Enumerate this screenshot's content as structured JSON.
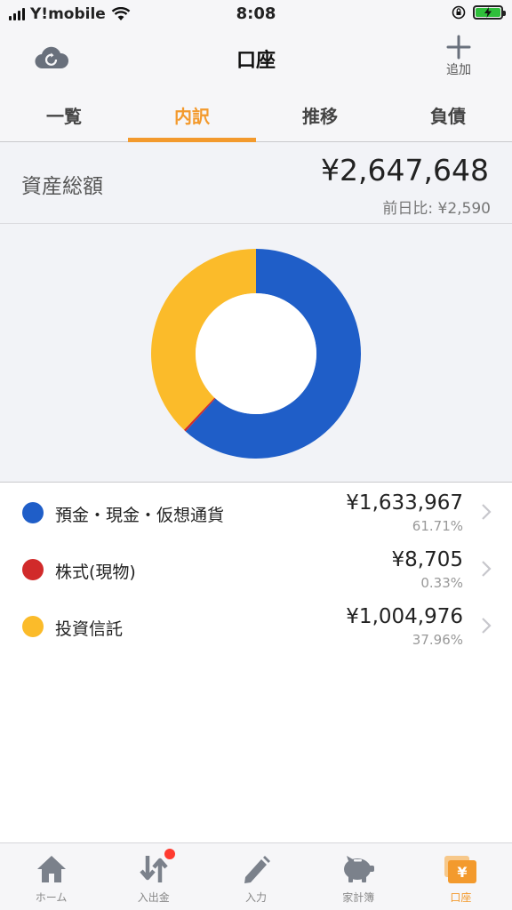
{
  "status_bar": {
    "carrier": "Y!mobile",
    "time": "8:08"
  },
  "nav": {
    "title": "口座",
    "add_label": "追加"
  },
  "tabs": [
    {
      "label": "一覧",
      "active": false
    },
    {
      "label": "内訳",
      "active": true
    },
    {
      "label": "推移",
      "active": false
    },
    {
      "label": "負債",
      "active": false
    }
  ],
  "total": {
    "label": "資産総額",
    "value": "¥2,647,648",
    "diff": "前日比: ¥2,590"
  },
  "chart_data": {
    "type": "pie",
    "categories": [
      "預金・現金・仮想通貨",
      "株式(現物)",
      "投資信託"
    ],
    "values": [
      1633967,
      8705,
      1004976
    ],
    "percentages": [
      61.71,
      0.33,
      37.96
    ],
    "colors": [
      "#1f5ec8",
      "#d12a2a",
      "#fbbb2a"
    ]
  },
  "breakdown": [
    {
      "label": "預金・現金・仮想通貨",
      "amount": "¥1,633,967",
      "percent": "61.71%",
      "color": "#1f5ec8"
    },
    {
      "label": "株式(現物)",
      "amount": "¥8,705",
      "percent": "0.33%",
      "color": "#d12a2a"
    },
    {
      "label": "投資信託",
      "amount": "¥1,004,976",
      "percent": "37.96%",
      "color": "#fbbb2a"
    }
  ],
  "tab_bar": [
    {
      "label": "ホーム",
      "icon": "home-icon",
      "active": false
    },
    {
      "label": "入出金",
      "icon": "transfer-icon",
      "active": false,
      "badge": true
    },
    {
      "label": "入力",
      "icon": "pencil-icon",
      "active": false
    },
    {
      "label": "家計簿",
      "icon": "piggy-bank-icon",
      "active": false
    },
    {
      "label": "口座",
      "icon": "wallet-icon",
      "active": true
    }
  ],
  "colors": {
    "accent": "#f39a2d"
  }
}
